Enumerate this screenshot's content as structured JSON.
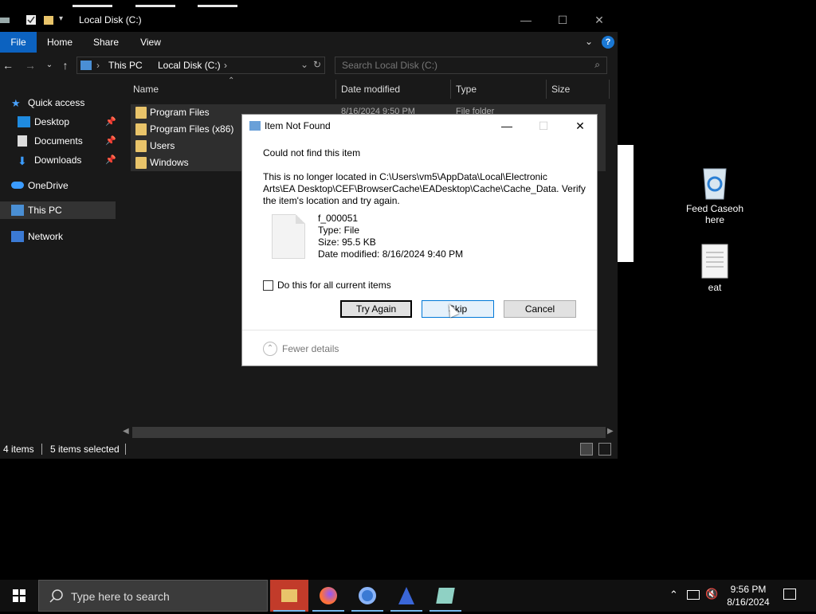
{
  "explorer": {
    "window_title": "Local Disk (C:)",
    "ribbon_tabs": [
      "File",
      "Home",
      "Share",
      "View"
    ],
    "help_label": "?",
    "address_crumbs": [
      "This PC",
      "Local Disk (C:)"
    ],
    "search_placeholder": "Search Local Disk (C:)",
    "columns": [
      "Name",
      "Date modified",
      "Type",
      "Size"
    ],
    "sidebar": [
      {
        "label": "Quick access",
        "icon": "star-icon"
      },
      {
        "label": "Desktop",
        "icon": "desktop-icon",
        "pinned": true
      },
      {
        "label": "Documents",
        "icon": "documents-icon",
        "pinned": true
      },
      {
        "label": "Downloads",
        "icon": "downloads-icon",
        "pinned": true
      },
      {
        "label": "OneDrive",
        "icon": "cloud-icon"
      },
      {
        "label": "This PC",
        "icon": "pc-icon",
        "selected": true
      },
      {
        "label": "Network",
        "icon": "network-icon"
      }
    ],
    "files": [
      {
        "name": "Program Files",
        "date": "8/16/2024 9:50 PM",
        "type": "File folder"
      },
      {
        "name": "Program Files (x86)"
      },
      {
        "name": "Users"
      },
      {
        "name": "Windows"
      }
    ],
    "status": {
      "items": "4 items",
      "selected": "5 items selected"
    }
  },
  "desktop": {
    "icons": [
      {
        "label": "Feed Caseoh here",
        "icon": "recycle-bin-icon"
      },
      {
        "label": "eat",
        "icon": "text-file-icon"
      }
    ]
  },
  "dialog": {
    "title": "Item Not Found",
    "heading": "Could not find this item",
    "message_line1": "This is no longer located in C:\\Users\\vm5\\AppData\\Local\\Electronic",
    "message_line2": "Arts\\EA Desktop\\CEF\\BrowserCache\\EADesktop\\Cache\\Cache_Data. Verify",
    "message_line3": "the item's location and try again.",
    "file": {
      "name": "f_000051",
      "type": "Type: File",
      "size": "Size: 95.5 KB",
      "modified": "Date modified: 8/16/2024 9:40 PM"
    },
    "checkbox_label": "Do this for all current items",
    "buttons": {
      "try_again": "Try Again",
      "skip": "Skip",
      "cancel": "Cancel"
    },
    "fewer_details": "Fewer details"
  },
  "taskbar": {
    "search_placeholder": "Type here to search",
    "time": "9:56 PM",
    "date": "8/16/2024"
  }
}
